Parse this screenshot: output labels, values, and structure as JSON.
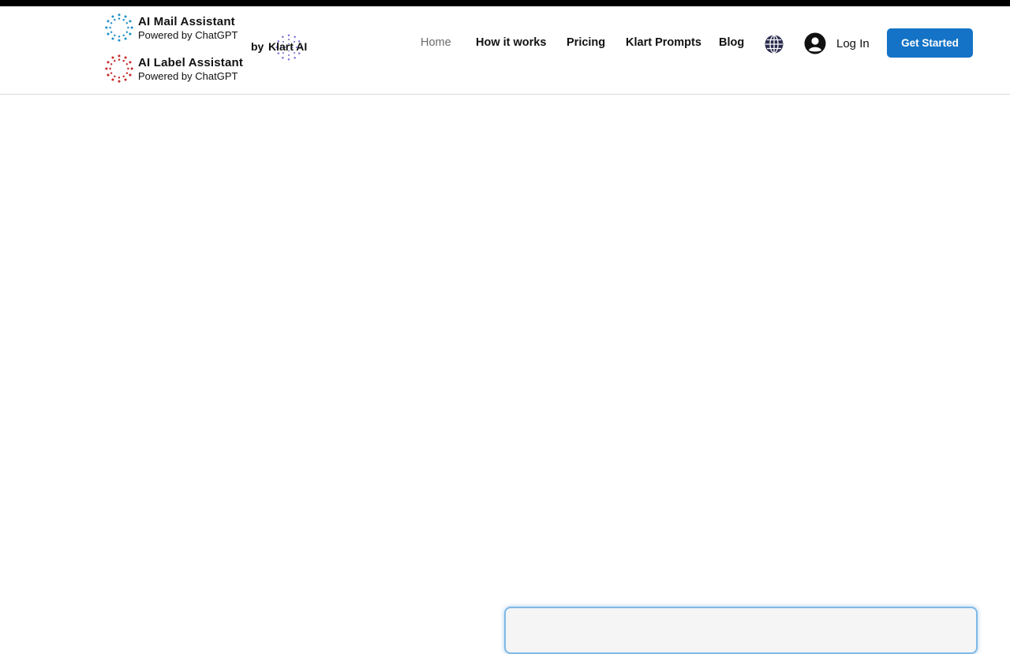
{
  "brands": {
    "mail": {
      "title": "AI Mail Assistant",
      "subtitle": "Powered by ChatGPT",
      "color": "#1e8fc8"
    },
    "label": {
      "title": "AI Label Assistant",
      "subtitle": "Powered by ChatGPT",
      "color": "#c62828"
    },
    "by_label": "by",
    "company": "Klart AI",
    "company_color": "#6a5acd"
  },
  "nav": {
    "items": [
      {
        "label": "Home",
        "active": true
      },
      {
        "label": "How it works",
        "active": false
      },
      {
        "label": "Pricing",
        "active": false
      },
      {
        "label": "Klart Prompts",
        "active": false
      },
      {
        "label": "Blog",
        "active": false
      }
    ],
    "language_icon": "globe-icon",
    "login_label": "Log In",
    "login_icon": "user-avatar-icon",
    "cta_label": "Get Started",
    "cta_color": "#1473c6"
  }
}
